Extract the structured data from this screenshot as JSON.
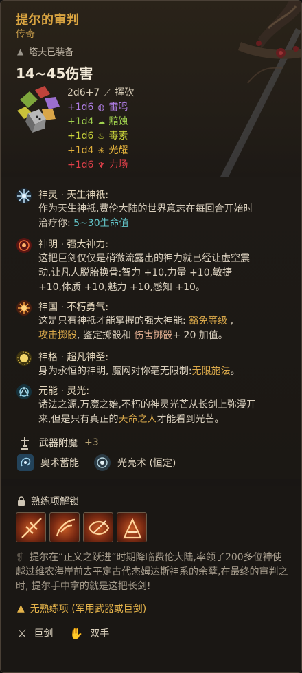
{
  "item": {
    "name": "提尔的审判",
    "rarity": "传奇",
    "equipped_by": "塔夫已装备",
    "damage": "14~45伤害"
  },
  "damage_lines": [
    {
      "dice": "2d6+7",
      "type": "挥砍",
      "icon": "slash-icon",
      "color": "#d8cdb8"
    },
    {
      "dice": "+1d6",
      "type": "雷鸣",
      "icon": "thunder-icon",
      "color": "#b07ee6"
    },
    {
      "dice": "+1d4",
      "type": "黯蚀",
      "icon": "acid-icon",
      "color": "#9fd04e"
    },
    {
      "dice": "+1d6",
      "type": "毒素",
      "icon": "poison-icon",
      "color": "#c7d13a"
    },
    {
      "dice": "+1d4",
      "type": "光耀",
      "icon": "radiant-icon",
      "color": "#e2b13c"
    },
    {
      "dice": "+1d6",
      "type": "力场",
      "icon": "force-icon",
      "color": "#e0404a"
    }
  ],
  "features": [
    {
      "title": "神灵 · 天生神祇:",
      "line1": "作为天生神祇,费伦大陆的世界意志在每回合开始时",
      "line2a": "治疗你: ",
      "line2b": "5~30生命值"
    },
    {
      "title": "神明 · 强大神力:",
      "line1": "这把巨剑仅仅是稍微流露出的神力就已经让虚空震",
      "line2": "动,让凡人脱胎换骨:智力 +10,力量 +10,敏捷",
      "line3": "+10,体质 +10,魅力 +10,感知 +10。"
    },
    {
      "title": "神国 · 不朽勇气:",
      "line1a": "这是只有神祇才能掌握的强大神能: ",
      "line1b": "豁免等级",
      "line1c": " ,",
      "line2a": "攻击掷骰",
      "line2b": ", 鉴定掷骰和 ",
      "line2c": "伤害掷骰",
      "line2d": "+ 20 加值。"
    },
    {
      "title": "神格 · 超凡神圣:",
      "line1a": "身为永恒的神明, 魔网对你毫无限制:",
      "line1b": "无限施法",
      "line1c": "。"
    },
    {
      "title": "元能 · 灵光:",
      "line1": "诸法之源,万魔之始,不朽的神灵光芒从长剑上弥漫开",
      "line2a": "来,但是只有真正的",
      "line2b": "天命之人",
      "line2c": "才能看到光芒。"
    }
  ],
  "enchant": {
    "label": "武器附魔",
    "value": "+3"
  },
  "spells": [
    {
      "name": "奥术蓄能",
      "icon": "arcane-charge-icon"
    },
    {
      "name": "光亮术 (恒定)",
      "icon": "light-spell-icon"
    }
  ],
  "proficiency": {
    "title": "熟练项解锁",
    "slots": [
      "weapon-action-1-icon",
      "weapon-action-2-icon",
      "weapon-action-3-icon",
      "weapon-action-4-icon"
    ]
  },
  "lore": "提尔在“正义之跃进”时期降临费伦大陆,率领了200多位神使越过维农海岸前去平定古代杰姆达斯神系的余孽,在最终的审判之时, 提尔手中拿的就是这把长剑!",
  "no_proficiency": "无熟练项 (军用武器或巨剑)",
  "properties": [
    {
      "label": "巨剑",
      "icon": "greatsword-icon"
    },
    {
      "label": "双手",
      "icon": "two-handed-icon"
    }
  ],
  "colors": {
    "title": "#d9a441",
    "teal": "#63c5c9",
    "gold": "#d9a84a",
    "warning": "#e3b24a"
  }
}
